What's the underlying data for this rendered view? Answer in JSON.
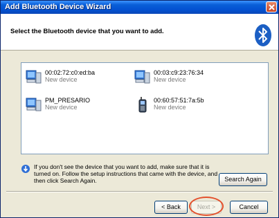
{
  "window": {
    "title": "Add Bluetooth Device Wizard"
  },
  "header": {
    "instruction": "Select the Bluetooth device that you want to add."
  },
  "devices": [
    {
      "name": "00:02:72:c0:ed:ba",
      "status": "New device",
      "icon": "computer-icon"
    },
    {
      "name": "00:03:c9:23:76:34",
      "status": "New device",
      "icon": "computer-icon"
    },
    {
      "name": "PM_PRESARIO",
      "status": "New device",
      "icon": "computer-icon"
    },
    {
      "name": "00:60:57:51:7a:5b",
      "status": "New device",
      "icon": "phone-icon"
    }
  ],
  "info": {
    "text": "If you don't see the device that you want to add, make sure that it is turned on. Follow the setup instructions that came with the device, and then click Search Again."
  },
  "buttons": {
    "search_again": "Search Again",
    "back": "< Back",
    "next": "Next >",
    "cancel": "Cancel"
  },
  "colors": {
    "titlebar": "#0351d0",
    "highlight": "#e4502c",
    "bluetooth": "#1c5fc4"
  }
}
